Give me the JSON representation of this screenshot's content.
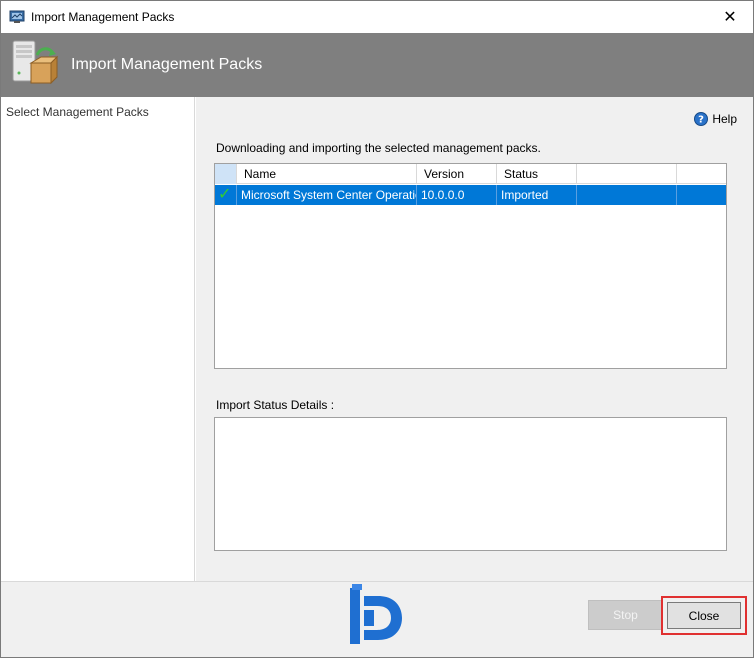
{
  "window": {
    "title": "Import Management Packs",
    "close_glyph": "✕"
  },
  "banner": {
    "title": "Import Management Packs",
    "icon": "management-pack-server-icon"
  },
  "nav": {
    "items": [
      {
        "label": "Select Management Packs"
      }
    ]
  },
  "content": {
    "help_label": "Help",
    "description": "Downloading and importing the selected management packs.",
    "list": {
      "columns": [
        "",
        "Name",
        "Version",
        "Status",
        "",
        ""
      ],
      "rows": [
        {
          "check": "✓",
          "name": "Microsoft System Center Operation...",
          "version": "10.0.0.0",
          "status": "Imported",
          "selected": true
        }
      ]
    },
    "status_details_label": "Import Status Details :",
    "status_details_text": ""
  },
  "footer": {
    "stop_label": "Stop",
    "close_label": "Close"
  },
  "colors": {
    "banner_bg": "#7f7f7f",
    "selection": "#0078d7",
    "check": "#33cc33",
    "highlight_border": "#e03030",
    "logo_blue": "#1f6fd1"
  }
}
